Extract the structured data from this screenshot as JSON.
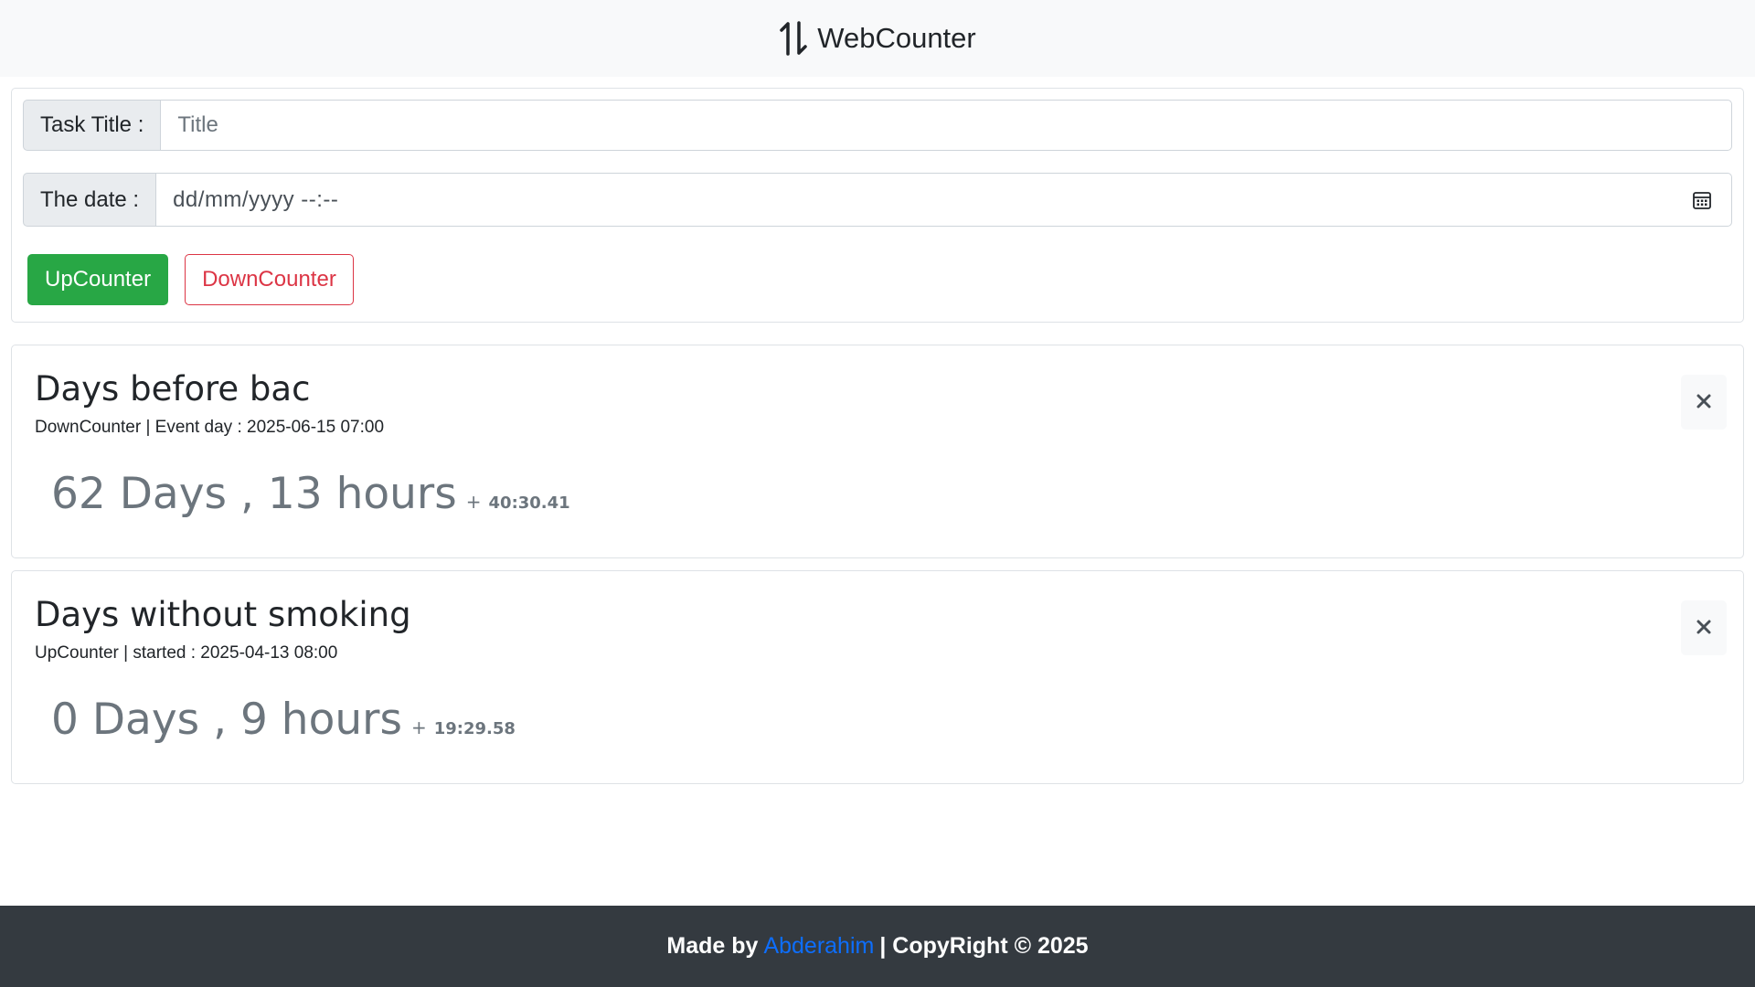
{
  "app": {
    "brand": "WebCounter",
    "logo_icon": "up-down-arrows-icon"
  },
  "form": {
    "title_label": "Task Title :",
    "title_placeholder": "Title",
    "title_value": "",
    "date_label": "The date :",
    "date_placeholder": "dd/mm/yyyy  --:--",
    "date_icon": "calendar-icon",
    "up_button": "UpCounter",
    "down_button": "DownCounter"
  },
  "counters": [
    {
      "title": "Days before bac",
      "subtitle": "DownCounter | Event day : 2025-06-15 07:00",
      "main": "62 Days , 13 hours",
      "plus": "+",
      "seconds": "40:30.41",
      "close_icon": "close-icon"
    },
    {
      "title": "Days without smoking",
      "subtitle": "UpCounter | started : 2025-04-13 08:00",
      "main": "0 Days , 9 hours",
      "plus": "+",
      "seconds": "19:29.58",
      "close_icon": "close-icon"
    }
  ],
  "footer": {
    "made_by": "Made by",
    "author": "Abderahim",
    "copyright": "| CopyRight © 2025"
  },
  "colors": {
    "navbar_bg": "#f8f9fa",
    "success": "#28a745",
    "danger": "#dc3545",
    "muted": "#6c757d",
    "footer_bg": "#343a40",
    "link": "#0d6efd"
  }
}
